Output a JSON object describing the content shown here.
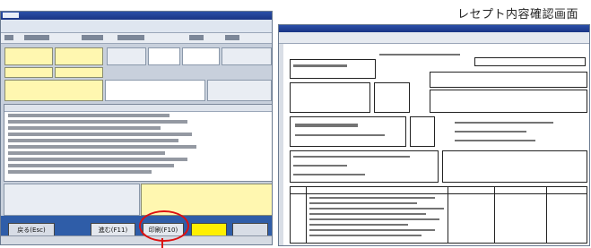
{
  "page": {
    "caption": "レセプト内容確認画面"
  },
  "left_window": {
    "footer": {
      "buttons": [
        {
          "label": "戻る(Esc)"
        },
        {
          "label": "進む(F11)"
        },
        {
          "label": "印刷(F10)"
        },
        {
          "label": "(yellow)"
        },
        {
          "label": "(blank)"
        }
      ]
    }
  },
  "right_window": {
    "name": "receipt-preview"
  },
  "colors": {
    "titlebar": "#1a3585",
    "footer": "#2f5da8",
    "highlight_circle": "#dd1111",
    "input_yellow": "#fff7b0",
    "button_yellow": "#ffef00"
  }
}
